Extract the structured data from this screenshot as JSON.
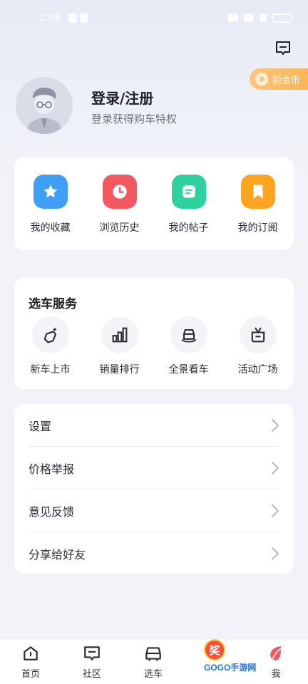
{
  "status_bar": {
    "time": "2:08"
  },
  "header": {
    "coin_label": "领金币"
  },
  "profile": {
    "title": "登录/注册",
    "subtitle": "登录获得购车特权"
  },
  "quick_actions": [
    {
      "label": "我的收藏",
      "icon": "star-icon",
      "color": "#3f9ff5"
    },
    {
      "label": "浏览历史",
      "icon": "clock-icon",
      "color": "#f2585d"
    },
    {
      "label": "我的帖子",
      "icon": "post-icon",
      "color": "#2fd1a0"
    },
    {
      "label": "我的订阅",
      "icon": "bookmark-icon",
      "color": "#ffa41f"
    }
  ],
  "services": {
    "title": "选车服务",
    "items": [
      {
        "label": "新车上市",
        "icon": "new-car-icon"
      },
      {
        "label": "销量排行",
        "icon": "ranking-icon"
      },
      {
        "label": "全景看车",
        "icon": "panorama-car-icon"
      },
      {
        "label": "活动广场",
        "icon": "gift-icon"
      }
    ]
  },
  "settings": [
    {
      "label": "设置"
    },
    {
      "label": "价格举报"
    },
    {
      "label": "意见反馈"
    },
    {
      "label": "分享给好友"
    }
  ],
  "tabs": [
    {
      "label": "首页",
      "icon": "home-icon"
    },
    {
      "label": "社区",
      "icon": "community-icon"
    },
    {
      "label": "选车",
      "icon": "car-icon"
    },
    {
      "label": "",
      "icon": "reward-icon",
      "badge": "奖"
    },
    {
      "label": "我",
      "icon": "me-icon"
    }
  ],
  "watermark": "GOGO手游网"
}
